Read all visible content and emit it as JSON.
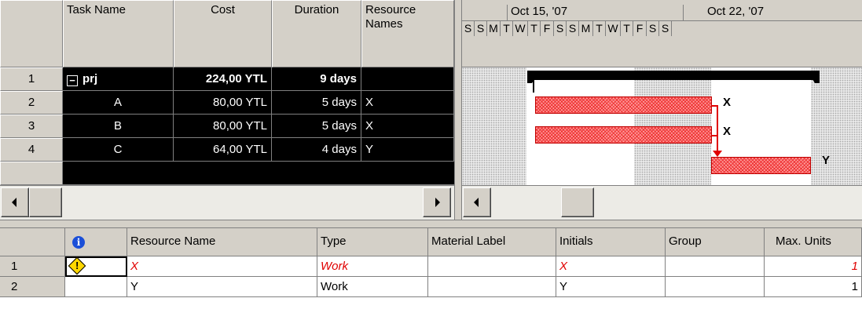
{
  "task_table": {
    "columns": [
      {
        "label": "Task Name"
      },
      {
        "label": "Cost"
      },
      {
        "label": "Duration"
      },
      {
        "label": "Resource Names"
      }
    ],
    "rows": [
      {
        "num": "1",
        "collapse": "−",
        "name": "prj",
        "cost": "224,00 YTL",
        "duration": "9 days",
        "resources": ""
      },
      {
        "num": "2",
        "name": "A",
        "cost": "80,00 YTL",
        "duration": "5 days",
        "resources": "X"
      },
      {
        "num": "3",
        "name": "B",
        "cost": "80,00 YTL",
        "duration": "5 days",
        "resources": "X"
      },
      {
        "num": "4",
        "name": "C",
        "cost": "64,00 YTL",
        "duration": "4 days",
        "resources": "Y"
      }
    ]
  },
  "gantt": {
    "weeks": [
      "Oct 15, '07",
      "Oct 22, '07"
    ],
    "days": [
      "S",
      "S",
      "M",
      "T",
      "W",
      "T",
      "F",
      "S",
      "S",
      "M",
      "T",
      "W",
      "T",
      "F",
      "S",
      "S"
    ],
    "bar_labels": [
      "X",
      "X",
      "Y"
    ],
    "colors": {
      "task_bar": "#ff9a9a",
      "task_border": "#c00000",
      "summary": "#000000"
    }
  },
  "resource_table": {
    "columns": [
      {
        "label": ""
      },
      {
        "label": "Resource Name"
      },
      {
        "label": "Type"
      },
      {
        "label": "Material Label"
      },
      {
        "label": "Initials"
      },
      {
        "label": "Group"
      },
      {
        "label": "Max. Units"
      }
    ],
    "info_icon": "info-icon",
    "rows": [
      {
        "num": "1",
        "indicator": "warning-icon",
        "name": "X",
        "type": "Work",
        "material": "",
        "initials": "X",
        "group": "",
        "max_units": "1"
      },
      {
        "num": "2",
        "indicator": "",
        "name": "Y",
        "type": "Work",
        "material": "",
        "initials": "Y",
        "group": "",
        "max_units": "1"
      }
    ]
  }
}
